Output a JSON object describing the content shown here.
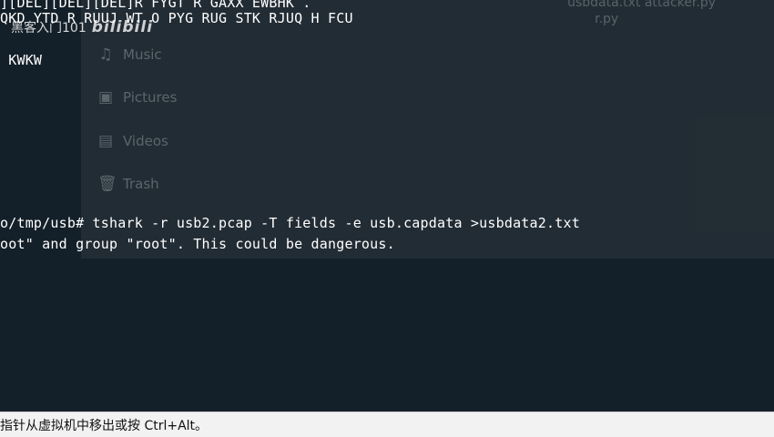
{
  "terminal": {
    "lines": [
      "][DEL][DEL][DEL]R FYGT R GAXX EWBHK .",
      "QKD YTD R RUUJ WT O PYG RUG STK RJUQ H FCU",
      " KWKW",
      "o/tmp/usb# tshark -r usb2.pcap -T fields -e usb.capdata >usbdata2.txt",
      "oot\" and group \"root\". This could be dangerous."
    ]
  },
  "watermark": {
    "text": "黑客入门101",
    "logo": "bilibili"
  },
  "background_window": {
    "sidebar": [
      {
        "label": "Music",
        "icon": "music-note-icon"
      },
      {
        "label": "Pictures",
        "icon": "pictures-icon"
      },
      {
        "label": "Videos",
        "icon": "videos-icon"
      },
      {
        "label": "Trash",
        "icon": "trash-icon"
      }
    ],
    "files": [
      "usbdata.txt   attacker.py",
      "r.py"
    ]
  },
  "status_bar": {
    "text": "指针从虚拟机中移出或按 Ctrl+Alt。"
  }
}
